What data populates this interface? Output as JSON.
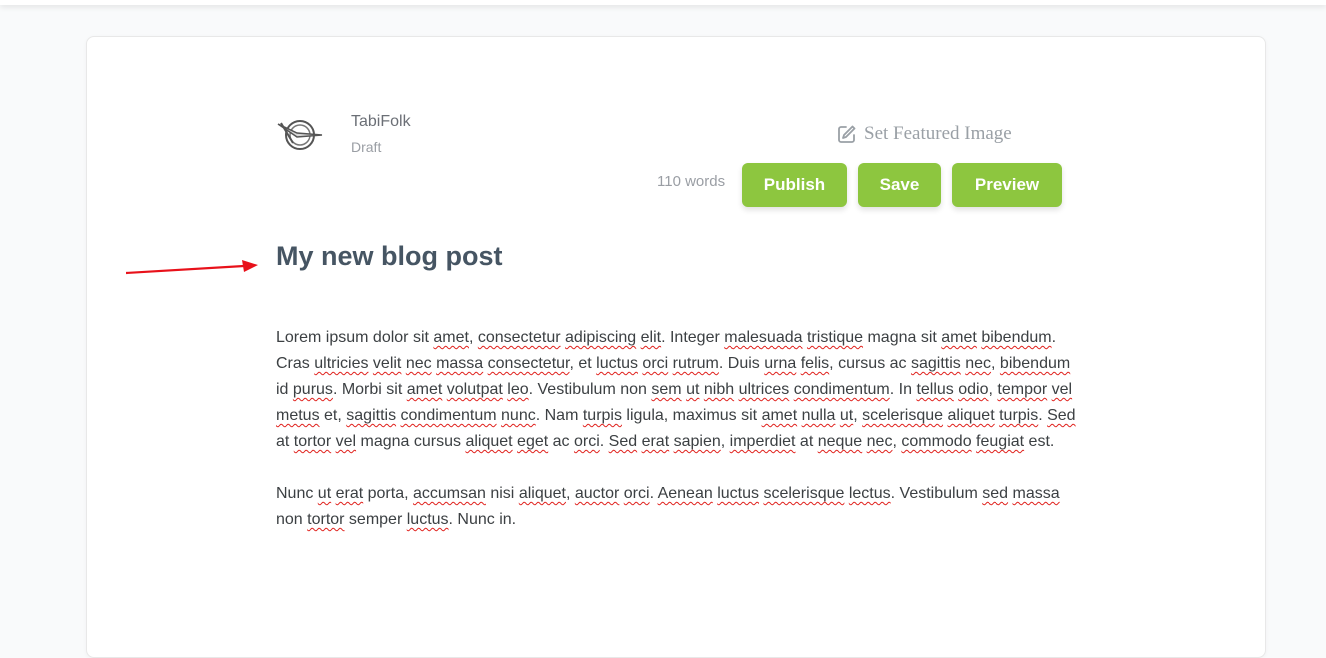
{
  "author": {
    "name": "TabiFolk",
    "status": "Draft"
  },
  "featured_image": {
    "label": "Set Featured Image",
    "icon": "edit-icon"
  },
  "word_count": "110 words",
  "buttons": {
    "publish": "Publish",
    "save": "Save",
    "preview": "Preview"
  },
  "post": {
    "title": "My new blog post",
    "paragraphs": [
      [
        {
          "t": "Lorem ipsum dolor sit ",
          "s": false
        },
        {
          "t": "amet",
          "s": true
        },
        {
          "t": ", ",
          "s": false
        },
        {
          "t": "consectetur",
          "s": true
        },
        {
          "t": " ",
          "s": false
        },
        {
          "t": "adipiscing",
          "s": true
        },
        {
          "t": " ",
          "s": false
        },
        {
          "t": "elit",
          "s": true
        },
        {
          "t": ". Integer ",
          "s": false
        },
        {
          "t": "malesuada",
          "s": true
        },
        {
          "t": " ",
          "s": false
        },
        {
          "t": "tristique",
          "s": true
        },
        {
          "t": " magna sit ",
          "s": false
        },
        {
          "t": "amet",
          "s": true
        },
        {
          "t": " ",
          "s": false
        },
        {
          "t": "bibendum",
          "s": true
        },
        {
          "t": ". Cras ",
          "s": false
        },
        {
          "t": "ultricies",
          "s": true
        },
        {
          "t": " ",
          "s": false
        },
        {
          "t": "velit",
          "s": true
        },
        {
          "t": " ",
          "s": false
        },
        {
          "t": "nec",
          "s": true
        },
        {
          "t": " ",
          "s": false
        },
        {
          "t": "massa",
          "s": true
        },
        {
          "t": " ",
          "s": false
        },
        {
          "t": "consectetur",
          "s": true
        },
        {
          "t": ", et ",
          "s": false
        },
        {
          "t": "luctus",
          "s": true
        },
        {
          "t": " ",
          "s": false
        },
        {
          "t": "orci",
          "s": true
        },
        {
          "t": " ",
          "s": false
        },
        {
          "t": "rutrum",
          "s": true
        },
        {
          "t": ". Duis ",
          "s": false
        },
        {
          "t": "urna",
          "s": true
        },
        {
          "t": " ",
          "s": false
        },
        {
          "t": "felis",
          "s": true
        },
        {
          "t": ", cursus ac ",
          "s": false
        },
        {
          "t": "sagittis",
          "s": true
        },
        {
          "t": " ",
          "s": false
        },
        {
          "t": "nec",
          "s": true
        },
        {
          "t": ", ",
          "s": false
        },
        {
          "t": "bibendum",
          "s": true
        },
        {
          "t": " id ",
          "s": false
        },
        {
          "t": "purus",
          "s": true
        },
        {
          "t": ". Morbi sit ",
          "s": false
        },
        {
          "t": "amet",
          "s": true
        },
        {
          "t": " ",
          "s": false
        },
        {
          "t": "volutpat",
          "s": true
        },
        {
          "t": " ",
          "s": false
        },
        {
          "t": "leo",
          "s": true
        },
        {
          "t": ". Vestibulum non ",
          "s": false
        },
        {
          "t": "sem",
          "s": true
        },
        {
          "t": " ",
          "s": false
        },
        {
          "t": "ut",
          "s": true
        },
        {
          "t": " ",
          "s": false
        },
        {
          "t": "nibh",
          "s": true
        },
        {
          "t": " ",
          "s": false
        },
        {
          "t": "ultrices",
          "s": true
        },
        {
          "t": " ",
          "s": false
        },
        {
          "t": "condimentum",
          "s": true
        },
        {
          "t": ". In ",
          "s": false
        },
        {
          "t": "tellus",
          "s": true
        },
        {
          "t": " ",
          "s": false
        },
        {
          "t": "odio",
          "s": true
        },
        {
          "t": ", ",
          "s": false
        },
        {
          "t": "tempor",
          "s": true
        },
        {
          "t": " ",
          "s": false
        },
        {
          "t": "vel",
          "s": true
        },
        {
          "t": " ",
          "s": false
        },
        {
          "t": "metus",
          "s": true
        },
        {
          "t": " et, ",
          "s": false
        },
        {
          "t": "sagittis",
          "s": true
        },
        {
          "t": " ",
          "s": false
        },
        {
          "t": "condimentum",
          "s": true
        },
        {
          "t": " ",
          "s": false
        },
        {
          "t": "nunc",
          "s": true
        },
        {
          "t": ". Nam ",
          "s": false
        },
        {
          "t": "turpis",
          "s": true
        },
        {
          "t": " ligula, maximus sit ",
          "s": false
        },
        {
          "t": "amet",
          "s": true
        },
        {
          "t": " ",
          "s": false
        },
        {
          "t": "nulla",
          "s": true
        },
        {
          "t": " ",
          "s": false
        },
        {
          "t": "ut",
          "s": true
        },
        {
          "t": ", ",
          "s": false
        },
        {
          "t": "scelerisque",
          "s": true
        },
        {
          "t": " ",
          "s": false
        },
        {
          "t": "aliquet",
          "s": true
        },
        {
          "t": " ",
          "s": false
        },
        {
          "t": "turpis",
          "s": true
        },
        {
          "t": ". ",
          "s": false
        },
        {
          "t": "Sed",
          "s": true
        },
        {
          "t": " at ",
          "s": false
        },
        {
          "t": "tortor",
          "s": true
        },
        {
          "t": " ",
          "s": false
        },
        {
          "t": "vel",
          "s": true
        },
        {
          "t": " magna cursus ",
          "s": false
        },
        {
          "t": "aliquet",
          "s": true
        },
        {
          "t": " ",
          "s": false
        },
        {
          "t": "eget",
          "s": true
        },
        {
          "t": " ac ",
          "s": false
        },
        {
          "t": "orci",
          "s": true
        },
        {
          "t": ". ",
          "s": false
        },
        {
          "t": "Sed",
          "s": true
        },
        {
          "t": " ",
          "s": false
        },
        {
          "t": "erat",
          "s": true
        },
        {
          "t": " ",
          "s": false
        },
        {
          "t": "sapien",
          "s": true
        },
        {
          "t": ", ",
          "s": false
        },
        {
          "t": "imperdiet",
          "s": true
        },
        {
          "t": " at ",
          "s": false
        },
        {
          "t": "neque",
          "s": true
        },
        {
          "t": " ",
          "s": false
        },
        {
          "t": "nec",
          "s": true
        },
        {
          "t": ", ",
          "s": false
        },
        {
          "t": "commodo",
          "s": true
        },
        {
          "t": " ",
          "s": false
        },
        {
          "t": "feugiat",
          "s": true
        },
        {
          "t": " est.",
          "s": false
        }
      ],
      [
        {
          "t": "Nunc ",
          "s": false
        },
        {
          "t": "ut",
          "s": true
        },
        {
          "t": " ",
          "s": false
        },
        {
          "t": "erat",
          "s": true
        },
        {
          "t": " porta, ",
          "s": false
        },
        {
          "t": "accumsan",
          "s": true
        },
        {
          "t": " nisi ",
          "s": false
        },
        {
          "t": "aliquet",
          "s": true
        },
        {
          "t": ", ",
          "s": false
        },
        {
          "t": "auctor",
          "s": true
        },
        {
          "t": " ",
          "s": false
        },
        {
          "t": "orci",
          "s": true
        },
        {
          "t": ". ",
          "s": false
        },
        {
          "t": "Aenean",
          "s": true
        },
        {
          "t": " ",
          "s": false
        },
        {
          "t": "luctus",
          "s": true
        },
        {
          "t": " ",
          "s": false
        },
        {
          "t": "scelerisque",
          "s": true
        },
        {
          "t": " ",
          "s": false
        },
        {
          "t": "lectus",
          "s": true
        },
        {
          "t": ". Vestibulum ",
          "s": false
        },
        {
          "t": "sed",
          "s": true
        },
        {
          "t": " ",
          "s": false
        },
        {
          "t": "massa",
          "s": true
        },
        {
          "t": " non ",
          "s": false
        },
        {
          "t": "tortor",
          "s": true
        },
        {
          "t": " semper ",
          "s": false
        },
        {
          "t": "luctus",
          "s": true
        },
        {
          "t": ". Nunc in.",
          "s": false
        }
      ]
    ]
  },
  "colors": {
    "accent": "#8dc63f",
    "spellcheck": "#e0201b",
    "arrow": "#e8111a",
    "title": "#465563"
  }
}
